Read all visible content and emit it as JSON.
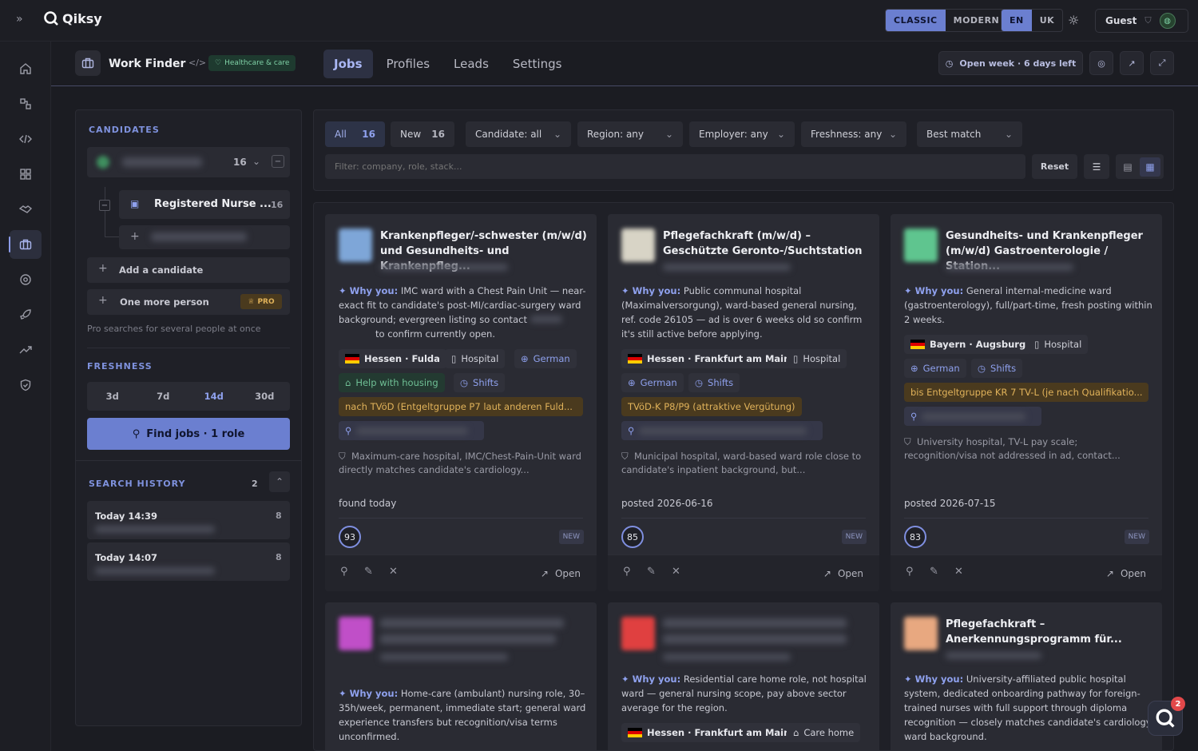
{
  "app": {
    "name": "Qiksy"
  },
  "topbar": {
    "style_options": [
      "CLASSIC",
      "MODERN"
    ],
    "active_style": "CLASSIC",
    "lang_options": [
      "EN",
      "UK"
    ],
    "active_lang": "EN",
    "user": "Guest"
  },
  "header": {
    "title": "Work Finder",
    "tag": "Healthcare & care",
    "tabs": [
      "Jobs",
      "Profiles",
      "Leads",
      "Settings"
    ],
    "active_tab": "Jobs",
    "open_week": "Open week · 6 days left"
  },
  "left": {
    "candidates_title": "CANDIDATES",
    "candidate_count": "16",
    "role_name": "Registered Nurse ...",
    "role_count": "16",
    "add_candidate": "Add a candidate",
    "one_more": "One more person",
    "pro": "PRO",
    "pro_note": "Pro searches for several people at once",
    "freshness_title": "FRESHNESS",
    "freshness": [
      "3d",
      "7d",
      "14d",
      "30d"
    ],
    "freshness_active": "14d",
    "find_jobs": "Find jobs · 1 role",
    "history_title": "SEARCH HISTORY",
    "history_count": "2",
    "history": [
      {
        "time": "Today 14:39",
        "count": "8"
      },
      {
        "time": "Today 14:07",
        "count": "8"
      }
    ]
  },
  "filters": {
    "all_label": "All",
    "all_count": "16",
    "new_label": "New",
    "new_count": "16",
    "candidate": "Candidate: all",
    "region": "Region: any",
    "employer": "Employer: any",
    "freshness": "Freshness: any",
    "sort": "Best match",
    "placeholder": "Filter: company, role, stack...",
    "reset": "Reset"
  },
  "cards": [
    {
      "title": "Krankenpfleger/-schwester (m/w/d) und Gesundheits- und Krankenpfleg...",
      "why_label": "✦ Why you:",
      "why": "IMC ward with a Chest Pain Unit — near-exact fit to candidate's post-MI/cardiac-surgery ward background; evergreen listing so contact",
      "why_tail": "to confirm currently open.",
      "location": "Hessen · Fulda",
      "type": "Hospital",
      "lang": "German",
      "housing": "Help with housing",
      "shifts": "Shifts",
      "salary": "nach TVöD (Entgeltgruppe P7 laut anderen Fuld...",
      "note": "Maximum-care hospital, IMC/Chest-Pain-Unit ward directly matches candidate's cardiology...",
      "posted": "found today",
      "score": "93",
      "badge": "NEW",
      "open": "Open",
      "thumb": "#7ea6d8"
    },
    {
      "title": "Pflegefachkraft (m/w/d) – Geschützte Geronto-/Suchtstation",
      "why_label": "✦ Why you:",
      "why": "Public communal hospital (Maximalversorgung), ward-based general nursing, ref. code 26105 — ad is over 6 weeks old so confirm it's still active before applying.",
      "location": "Hessen · Frankfurt am Main",
      "type": "Hospital",
      "lang": "German",
      "shifts": "Shifts",
      "salary": "TVöD-K P8/P9 (attraktive Vergütung)",
      "note": "Municipal hospital, ward-based ward role close to candidate's inpatient background, but...",
      "posted": "posted 2026-06-16",
      "score": "85",
      "badge": "NEW",
      "open": "Open",
      "thumb": "#d8d4c6"
    },
    {
      "title": "Gesundheits- und Krankenpfleger (m/w/d) Gastroenterologie / Station...",
      "why_label": "✦ Why you:",
      "why": "General internal-medicine ward (gastroenterology), full/part-time, fresh posting within 2 weeks.",
      "location": "Bayern · Augsburg",
      "type": "Hospital",
      "lang": "German",
      "shifts": "Shifts",
      "salary": "bis Entgeltgruppe KR 7 TV-L (je nach Qualifikatio...",
      "note": "University hospital, TV-L pay scale; recognition/visa not addressed in ad, contact...",
      "posted": "posted 2026-07-15",
      "score": "83",
      "badge": "NEW",
      "open": "Open",
      "thumb": "#5fc58f"
    },
    {
      "title": "",
      "why_label": "✦ Why you:",
      "why": "Home-care (ambulant) nursing role, 30–35h/week, permanent, immediate start; general ward experience transfers but recognition/visa terms unconfirmed.",
      "thumb": "#c04fc8"
    },
    {
      "title": "",
      "why_label": "✦ Why you:",
      "why": "Residential care home role, not hospital ward — general nursing scope, pay above sector average for the region.",
      "location": "Hessen · Frankfurt am Main",
      "type": "Care home",
      "thumb": "#e04040"
    },
    {
      "title": "Pflegefachkraft – Anerkennungsprogramm für...",
      "why_label": "✦ Why you:",
      "why": "University-affiliated public hospital system, dedicated onboarding pathway for foreign-trained nurses with full support through diploma recognition — closely matches candidate's cardiology ward background.",
      "thumb": "#e8a880"
    }
  ],
  "fab_badge": "2"
}
